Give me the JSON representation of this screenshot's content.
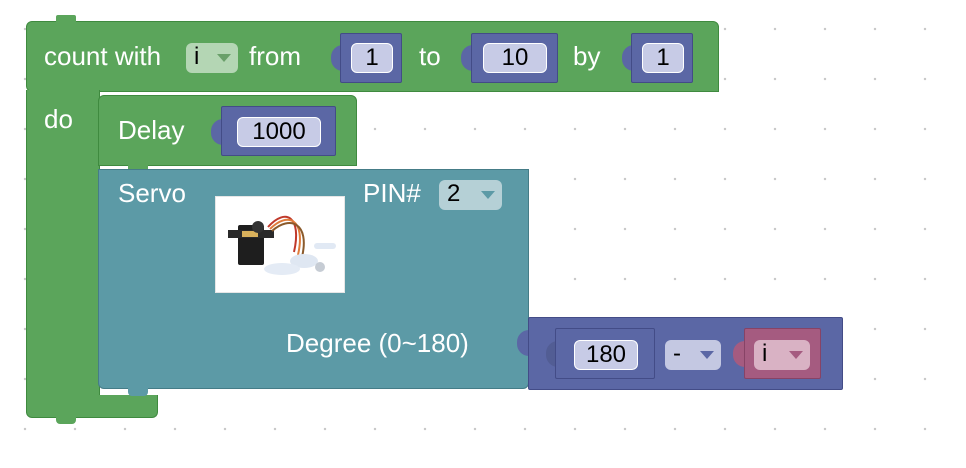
{
  "loop_block": {
    "count_with_label": "count with",
    "var": "i",
    "from_label": "from",
    "from_value": "1",
    "to_label": "to",
    "to_value": "10",
    "by_label": "by",
    "by_value": "1",
    "do_label": "do"
  },
  "delay_block": {
    "label": "Delay",
    "value": "1000"
  },
  "servo_block": {
    "label": "Servo",
    "pin_label": "PIN#",
    "pin_value": "2",
    "degree_label": "Degree (0~180)"
  },
  "math_block": {
    "left_value": "180",
    "operator": "-",
    "right_var": "i"
  },
  "colors": {
    "loop": "#5ba55b",
    "servo": "#5c9aa6",
    "math": "#5b67a5",
    "variable": "#a55b80"
  }
}
